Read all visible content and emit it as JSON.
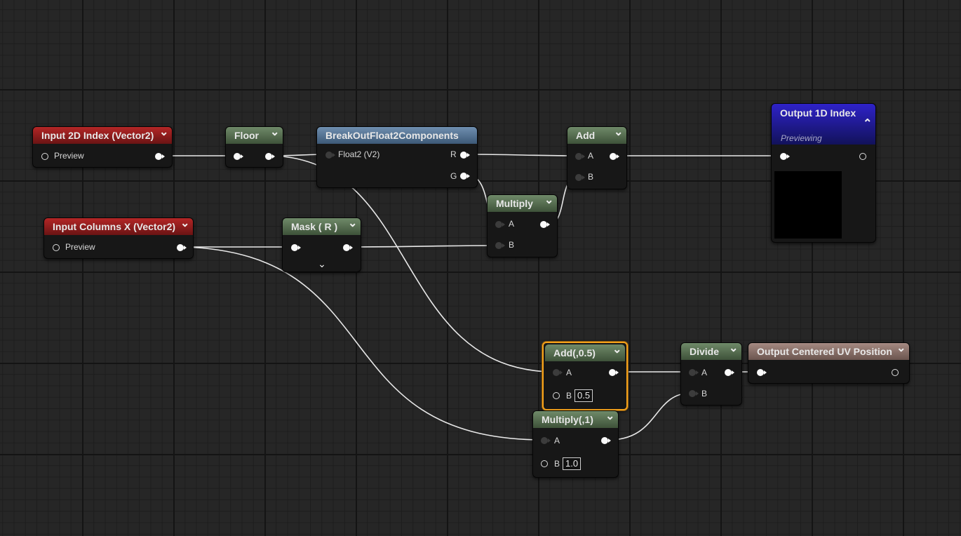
{
  "nodes": {
    "input_2d_index": {
      "title": "Input 2D Index (Vector2)",
      "pin_label": "Preview"
    },
    "floor": {
      "title": "Floor"
    },
    "breakout": {
      "title": "BreakOutFloat2Components",
      "input_label": "Float2 (V2)",
      "out_r": "R",
      "out_g": "G"
    },
    "add": {
      "title": "Add",
      "a": "A",
      "b": "B"
    },
    "output_1d": {
      "title": "Output 1D Index",
      "subtitle": "Previewing"
    },
    "input_columns": {
      "title": "Input Columns X (Vector2)",
      "pin_label": "Preview"
    },
    "mask": {
      "title": "Mask ( R )"
    },
    "multiply": {
      "title": "Multiply",
      "a": "A",
      "b": "B"
    },
    "add_half": {
      "title": "Add(,0.5)",
      "a": "A",
      "b": "B",
      "b_value": "0.5"
    },
    "divide": {
      "title": "Divide",
      "a": "A",
      "b": "B"
    },
    "output_uv": {
      "title": "Output Centered UV Position"
    },
    "multiply_one": {
      "title": "Multiply(,1)",
      "a": "A",
      "b": "B",
      "b_value": "1.0"
    }
  },
  "colors": {
    "input_header": "#b42626",
    "op_header": "#6f8a69",
    "breakout_header": "#6f8fb0",
    "output_header": "#2e22c8",
    "output_uv_header": "#a58a82",
    "selection": "#f5a21b",
    "wire": "#e8e8e8"
  }
}
